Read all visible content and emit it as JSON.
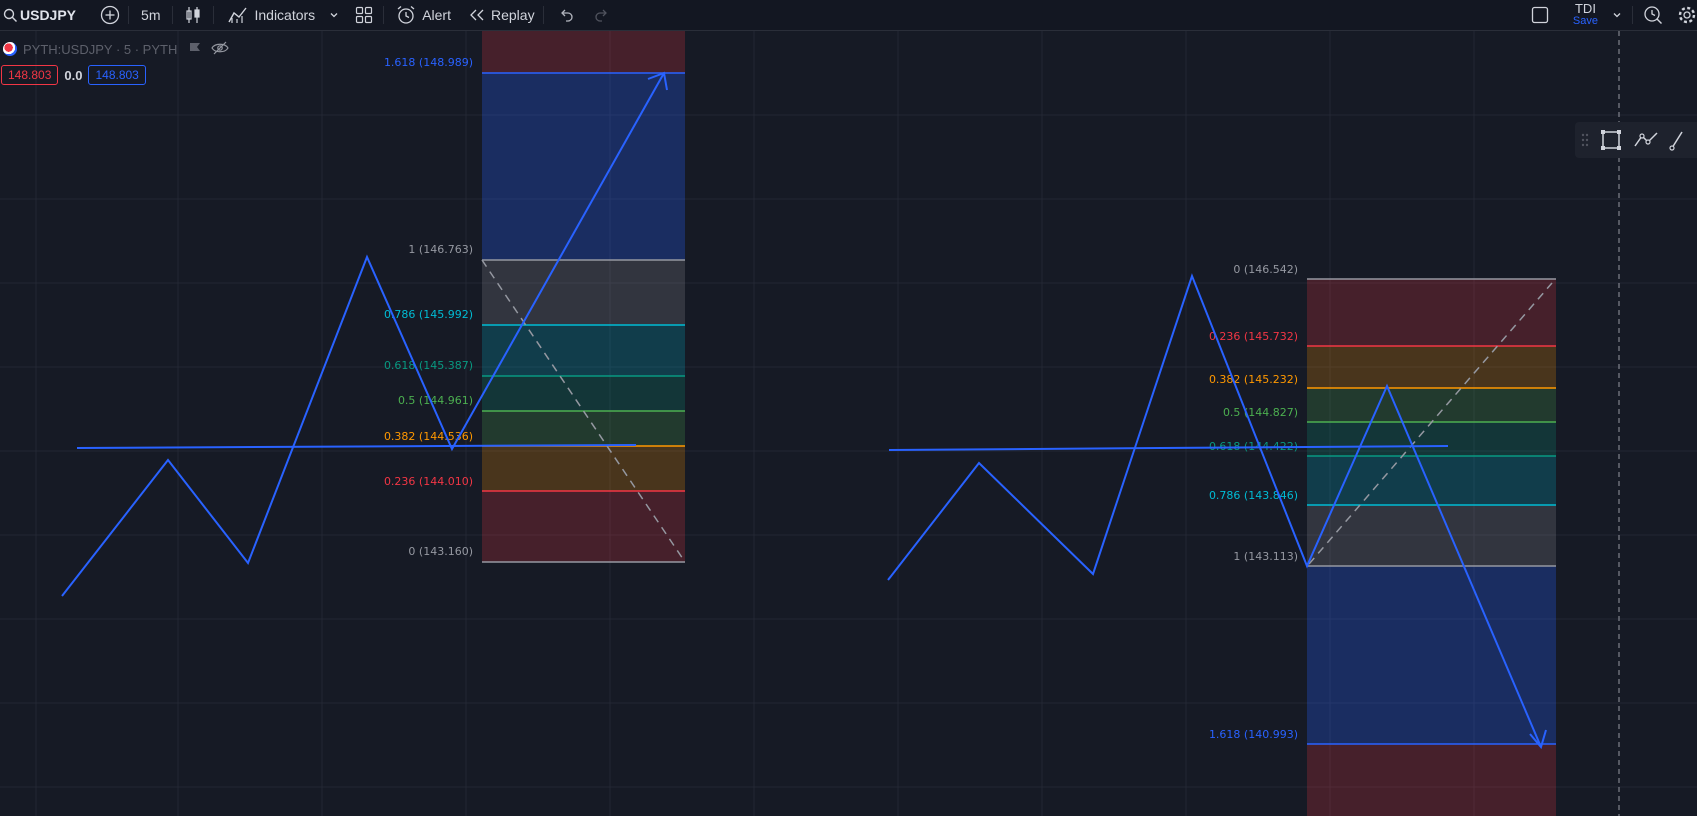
{
  "toolbar": {
    "symbol": "USDJPY",
    "interval": "5m",
    "indicators_label": "Indicators",
    "alert_label": "Alert",
    "replay_label": "Replay",
    "layout_name": "TDI",
    "save_label": "Save"
  },
  "legend": {
    "title": "PYTH:USDJPY · 5 · PYTH",
    "bid": "148.803",
    "spread": "0.0",
    "ask": "148.803"
  },
  "colors": {
    "background": "#161a25",
    "drawing_blue": "#2962ff",
    "fib_grey": "#9598a1",
    "fib_red": "#f23645",
    "fib_orange": "#ff9800",
    "fib_green": "#4caf50",
    "fib_teal": "#089981",
    "fib_cyan": "#00bcd4"
  },
  "fib_left": {
    "levels": [
      {
        "ratio": "1.618",
        "price": "148.989",
        "label": "1.618 (148.989)",
        "color": "#2962ff"
      },
      {
        "ratio": "1",
        "price": "146.763",
        "label": "1 (146.763)",
        "color": "#9598a1"
      },
      {
        "ratio": "0.786",
        "price": "145.992",
        "label": "0.786 (145.992)",
        "color": "#00bcd4"
      },
      {
        "ratio": "0.618",
        "price": "145.387",
        "label": "0.618 (145.387)",
        "color": "#089981"
      },
      {
        "ratio": "0.5",
        "price": "144.961",
        "label": "0.5 (144.961)",
        "color": "#4caf50"
      },
      {
        "ratio": "0.382",
        "price": "144.536",
        "label": "0.382 (144.536)",
        "color": "#ff9800"
      },
      {
        "ratio": "0.236",
        "price": "144.010",
        "label": "0.236 (144.010)",
        "color": "#f23645"
      },
      {
        "ratio": "0",
        "price": "143.160",
        "label": "0 (143.160)",
        "color": "#9598a1"
      }
    ]
  },
  "fib_right": {
    "levels": [
      {
        "ratio": "0",
        "price": "146.542",
        "label": "0 (146.542)",
        "color": "#9598a1"
      },
      {
        "ratio": "0.236",
        "price": "145.732",
        "label": "0.236 (145.732)",
        "color": "#f23645"
      },
      {
        "ratio": "0.382",
        "price": "145.232",
        "label": "0.382 (145.232)",
        "color": "#ff9800"
      },
      {
        "ratio": "0.5",
        "price": "144.827",
        "label": "0.5 (144.827)",
        "color": "#4caf50"
      },
      {
        "ratio": "0.618",
        "price": "144.422",
        "label": "0.618 (144.422)",
        "color": "#089981"
      },
      {
        "ratio": "0.786",
        "price": "143.846",
        "label": "0.786 (143.846)",
        "color": "#00bcd4"
      },
      {
        "ratio": "1",
        "price": "143.113",
        "label": "1 (143.113)",
        "color": "#9598a1"
      },
      {
        "ratio": "1.618",
        "price": "140.993",
        "label": "1.618 (140.993)",
        "color": "#2962ff"
      }
    ]
  },
  "icons": {
    "search": "search-icon",
    "compare": "plus-circle-icon",
    "chart_type": "candles-icon",
    "indicators": "indicators-icon",
    "templates": "grid-icon",
    "alert": "alarm-clock-icon",
    "replay": "rewind-icon",
    "undo": "undo-icon",
    "redo": "redo-icon",
    "fullscreen": "square-icon",
    "quick_search": "quick-search-icon",
    "settings": "gear-icon",
    "drag": "drag-handle-icon",
    "rect": "rectangle-tool-icon",
    "path": "path-tool-icon",
    "trend": "trendline-tool-icon"
  }
}
